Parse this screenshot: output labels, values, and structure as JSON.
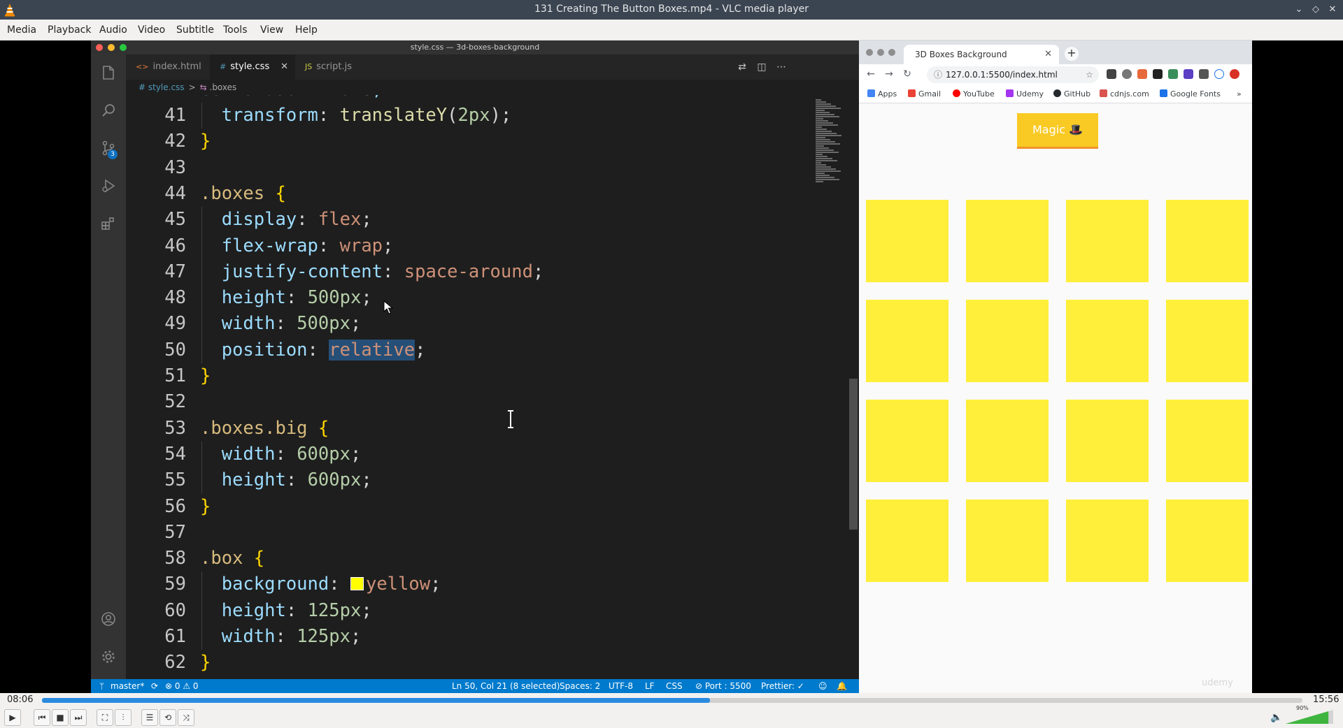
{
  "vlc": {
    "title": "131 Creating The Button Boxes.mp4 - VLC media player",
    "menu": [
      "Media",
      "Playback",
      "Audio",
      "Video",
      "Subtitle",
      "Tools",
      "View",
      "Help"
    ],
    "time_elapsed": "08:06",
    "time_total": "15:56",
    "progress": 0.53,
    "volume_label": "90%",
    "volume": 0.9
  },
  "vscode": {
    "window_title": "style.css — 3d-boxes-background",
    "tabs": [
      {
        "icon": "<>",
        "label": "index.html"
      },
      {
        "icon": "#",
        "label": "style.css"
      },
      {
        "icon": "JS",
        "label": "script.js"
      }
    ],
    "breadcrumb": {
      "file": "# style.css",
      "symbol": ".boxes"
    },
    "source_control_badge": "3",
    "cut_line": "box-shadow: none;",
    "code_lines": [
      {
        "n": "41",
        "tokens": [
          {
            "t": "  "
          },
          {
            "t": "transform",
            "c": "prop"
          },
          {
            "t": ": "
          },
          {
            "t": "translateY",
            "c": "fn"
          },
          {
            "t": "("
          },
          {
            "t": "2px",
            "c": "num"
          },
          {
            "t": ");"
          }
        ]
      },
      {
        "n": "42",
        "tokens": [
          {
            "t": "}",
            "c": "brace"
          }
        ]
      },
      {
        "n": "43",
        "tokens": []
      },
      {
        "n": "44",
        "tokens": [
          {
            "t": ".boxes",
            "c": "sel"
          },
          {
            "t": " "
          },
          {
            "t": "{",
            "c": "brace"
          }
        ]
      },
      {
        "n": "45",
        "tokens": [
          {
            "t": "  "
          },
          {
            "t": "display",
            "c": "prop"
          },
          {
            "t": ": "
          },
          {
            "t": "flex",
            "c": "val"
          },
          {
            "t": ";"
          }
        ]
      },
      {
        "n": "46",
        "tokens": [
          {
            "t": "  "
          },
          {
            "t": "flex-wrap",
            "c": "prop"
          },
          {
            "t": ": "
          },
          {
            "t": "wrap",
            "c": "val"
          },
          {
            "t": ";"
          }
        ]
      },
      {
        "n": "47",
        "tokens": [
          {
            "t": "  "
          },
          {
            "t": "justify-content",
            "c": "prop"
          },
          {
            "t": ": "
          },
          {
            "t": "space-around",
            "c": "val"
          },
          {
            "t": ";"
          }
        ]
      },
      {
        "n": "48",
        "tokens": [
          {
            "t": "  "
          },
          {
            "t": "height",
            "c": "prop"
          },
          {
            "t": ": "
          },
          {
            "t": "500px",
            "c": "num"
          },
          {
            "t": ";"
          }
        ]
      },
      {
        "n": "49",
        "tokens": [
          {
            "t": "  "
          },
          {
            "t": "width",
            "c": "prop"
          },
          {
            "t": ": "
          },
          {
            "t": "500px",
            "c": "num"
          },
          {
            "t": ";"
          }
        ]
      },
      {
        "n": "50",
        "tokens": [
          {
            "t": "  "
          },
          {
            "t": "position",
            "c": "prop"
          },
          {
            "t": ": "
          },
          {
            "t": "relative",
            "c": "val",
            "sel": true
          },
          {
            "t": ";"
          }
        ]
      },
      {
        "n": "51",
        "tokens": [
          {
            "t": "}",
            "c": "brace"
          }
        ]
      },
      {
        "n": "52",
        "tokens": []
      },
      {
        "n": "53",
        "tokens": [
          {
            "t": ".boxes.big",
            "c": "sel"
          },
          {
            "t": " "
          },
          {
            "t": "{",
            "c": "brace"
          }
        ]
      },
      {
        "n": "54",
        "tokens": [
          {
            "t": "  "
          },
          {
            "t": "width",
            "c": "prop"
          },
          {
            "t": ": "
          },
          {
            "t": "600px",
            "c": "num"
          },
          {
            "t": ";"
          }
        ]
      },
      {
        "n": "55",
        "tokens": [
          {
            "t": "  "
          },
          {
            "t": "height",
            "c": "prop"
          },
          {
            "t": ": "
          },
          {
            "t": "600px",
            "c": "num"
          },
          {
            "t": ";"
          }
        ]
      },
      {
        "n": "56",
        "tokens": [
          {
            "t": "}",
            "c": "brace"
          }
        ]
      },
      {
        "n": "57",
        "tokens": []
      },
      {
        "n": "58",
        "tokens": [
          {
            "t": ".box",
            "c": "sel"
          },
          {
            "t": " "
          },
          {
            "t": "{",
            "c": "brace"
          }
        ]
      },
      {
        "n": "59",
        "tokens": [
          {
            "t": "  "
          },
          {
            "t": "background",
            "c": "prop"
          },
          {
            "t": ": "
          },
          {
            "swatch": true
          },
          {
            "t": "yellow",
            "c": "val"
          },
          {
            "t": ";"
          }
        ]
      },
      {
        "n": "60",
        "tokens": [
          {
            "t": "  "
          },
          {
            "t": "height",
            "c": "prop"
          },
          {
            "t": ": "
          },
          {
            "t": "125px",
            "c": "num"
          },
          {
            "t": ";"
          }
        ]
      },
      {
        "n": "61",
        "tokens": [
          {
            "t": "  "
          },
          {
            "t": "width",
            "c": "prop"
          },
          {
            "t": ": "
          },
          {
            "t": "125px",
            "c": "num"
          },
          {
            "t": ";"
          }
        ]
      },
      {
        "n": "62",
        "tokens": [
          {
            "t": "}",
            "c": "brace"
          }
        ]
      }
    ],
    "status": {
      "branch": "master*",
      "problems": "⊗ 0 ⚠ 0",
      "cursor": "Ln 50, Col 21 (8 selected)",
      "spaces": "Spaces: 2",
      "encoding": "UTF-8",
      "eol": "LF",
      "language": "CSS",
      "port": "⊘ Port : 5500",
      "prettier": "Prettier: ✓"
    }
  },
  "browser": {
    "tab_title": "3D Boxes Background",
    "url": "127.0.0.1:5500/index.html",
    "bookmarks": [
      "Apps",
      "Gmail",
      "YouTube",
      "Udemy",
      "GitHub",
      "cdnjs.com",
      "Google Fonts"
    ],
    "button_label": "Magic 🎩",
    "watermark": "udemy",
    "box_count": 16
  },
  "colors": {
    "vscode_bg": "#1e1e1e",
    "statusbar": "#007acc",
    "box_yellow": "#ffef3a",
    "magic_button": "#f9ca24"
  }
}
